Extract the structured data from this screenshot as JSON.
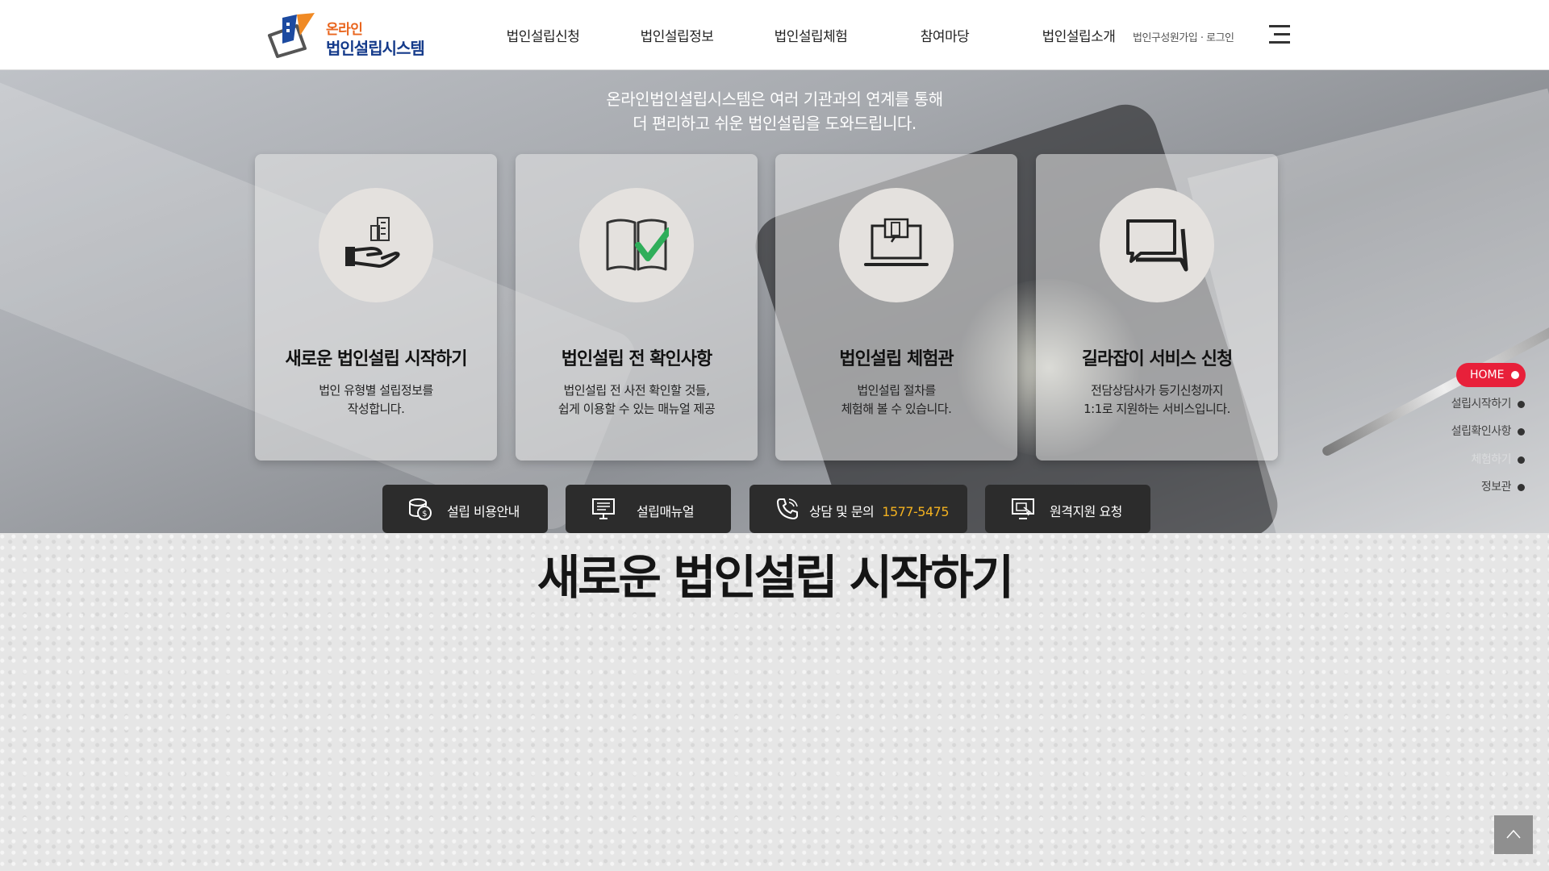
{
  "header": {
    "logo": {
      "small": "온라인",
      "big": "법인설립시스템"
    },
    "nav": [
      {
        "label": "법인설립신청"
      },
      {
        "label": "법인설립정보"
      },
      {
        "label": "법인설립체험"
      },
      {
        "label": "참여마당"
      },
      {
        "label": "법인설립소개"
      }
    ],
    "util": "법인구성원가입 · 로그인"
  },
  "hero": {
    "intro_line1": "온라인법인설립시스템은 여러 기관과의 연계를 통해",
    "intro_line2": "더 편리하고 쉬운 법인설립을 도와드립니다.",
    "cards": [
      {
        "title": "새로운 법인설립 시작하기",
        "desc1": "법인 유형별 설립정보를",
        "desc2": "작성합니다.",
        "icon": "hand-building-icon"
      },
      {
        "title": "법인설립 전 확인사항",
        "desc1": "법인설립 전 사전 확인할 것들,",
        "desc2": "쉽게 이용할 수 있는 매뉴얼 제공",
        "icon": "book-check-icon"
      },
      {
        "title": "법인설립 체험관",
        "desc1": "법인설립 절차를",
        "desc2": "체험해 볼 수 있습니다.",
        "icon": "laptop-building-icon"
      },
      {
        "title": "길라잡이 서비스 신청",
        "desc1": "전담상담사가 등기신청까지",
        "desc2": "1:1로 지원하는 서비스입니다.",
        "icon": "chat-bubbles-icon"
      }
    ],
    "quick": [
      {
        "label": "설립 비용안내",
        "icon": "coins-icon"
      },
      {
        "label": "설립매뉴얼",
        "icon": "monitor-icon"
      },
      {
        "label": "상담 및 문의",
        "phone": "1577-5475",
        "icon": "phone-icon"
      },
      {
        "label": "원격지원 요청",
        "icon": "remote-monitor-icon"
      }
    ]
  },
  "section": {
    "title": "새로운 법인설립 시작하기"
  },
  "sidenav": {
    "home": "HOME",
    "items": [
      "설립시작하기",
      "설립확인사항",
      "체험하기",
      "정보관"
    ]
  },
  "colors": {
    "accent_red": "#e8203a",
    "phone_yellow": "#f2b120",
    "logo_orange": "#e9661f",
    "logo_blue": "#143a8a"
  }
}
